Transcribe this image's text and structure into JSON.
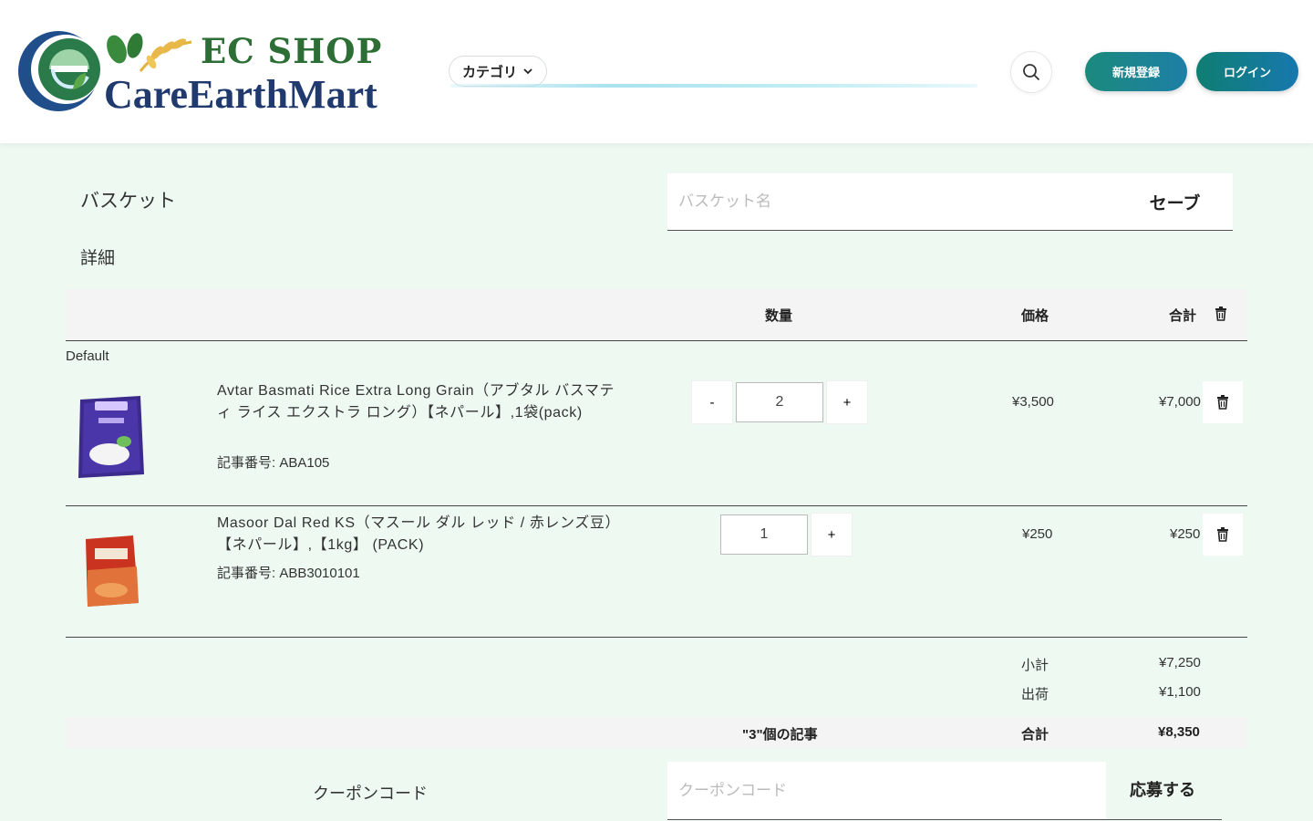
{
  "brand": {
    "top_line": "EC SHOP",
    "bottom_line": "CareEarthMart",
    "colors": {
      "green": "#2c6e35",
      "navy": "#203a6e"
    }
  },
  "header": {
    "category_label": "カテゴリ",
    "search_value": "",
    "search_icon": "search-icon",
    "register_label": "新規登録",
    "login_label": "ログイン",
    "accent_color": "#1b8a7c"
  },
  "basket": {
    "title": "バスケット",
    "details": "詳細",
    "name_placeholder": "バスケット名",
    "name_value": "",
    "save_label": "セーブ"
  },
  "table": {
    "col_qty": "数量",
    "col_price": "価格",
    "col_total": "合計",
    "group": "Default",
    "rows": [
      {
        "name": "Avtar Basmati Rice Extra Long Grain（アブタル バスマティ ライス エクストラ ロング）【ネパール】,1袋(pack)",
        "sku": "記事番号: ABA105",
        "qty": "2",
        "minus": "-",
        "plus": "+",
        "price": "¥3,500",
        "total": "¥7,000"
      },
      {
        "name": "Masoor Dal Red KS（マスール ダル レッド / 赤レンズ豆）【ネパール】,【1kg】 (PACK)",
        "sku": "記事番号: ABB3010101",
        "qty": "1",
        "plus": "+",
        "price": "¥250",
        "total": "¥250"
      }
    ]
  },
  "summary": {
    "subtotal_label": "小計",
    "subtotal": "¥7,250",
    "shipping_label": "出荷",
    "shipping": "¥1,100",
    "items_count": "\"3\"個の記事",
    "total_label": "合計",
    "total": "¥8,350"
  },
  "coupon": {
    "label": "クーポンコード",
    "placeholder": "クーポンコード",
    "value": "",
    "apply_label": "応募する"
  }
}
